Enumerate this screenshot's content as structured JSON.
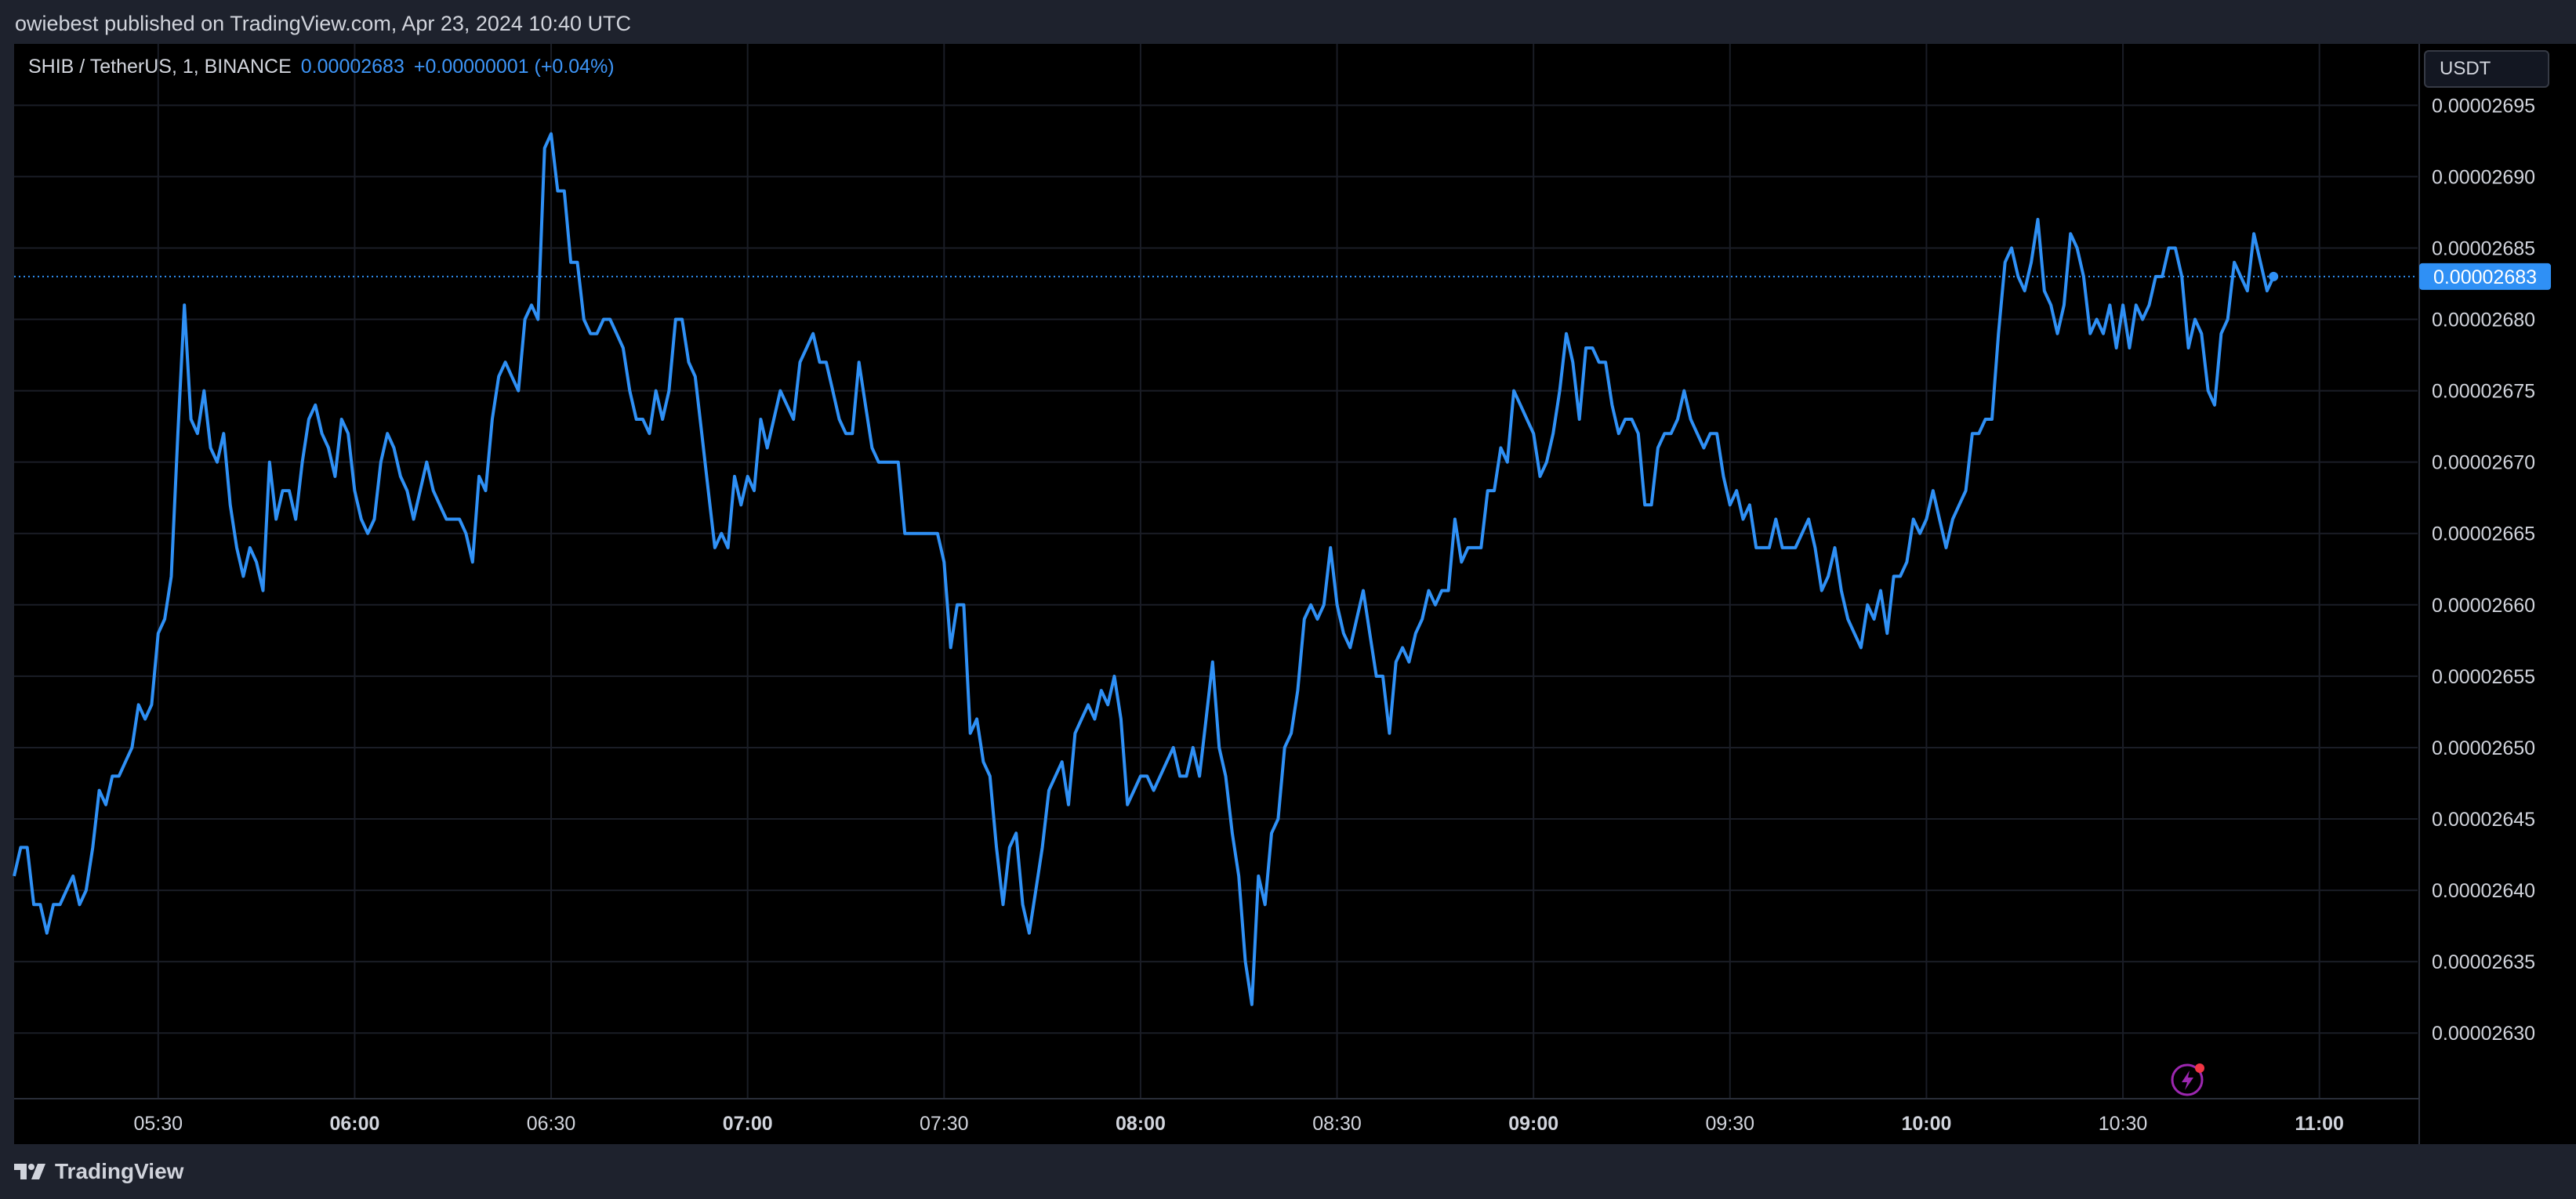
{
  "header": {
    "publish_text": "owiebest published on TradingView.com, Apr 23, 2024 10:40 UTC"
  },
  "legend": {
    "symbol": "SHIB / TetherUS, 1, BINANCE",
    "price": "0.00002683",
    "change": "+0.00000001 (+0.04%)"
  },
  "currency_button": "USDT",
  "footer": {
    "brand": "TradingView"
  },
  "colors": {
    "line": "#2f90f5",
    "price_label_bg": "#2f90f5",
    "background": "#000000",
    "grid": "#1a1d26",
    "axis_text": "#d1d4dc",
    "header_bg": "#1e222d"
  },
  "icons": {
    "lightning": "lightning-bolt-icon",
    "logo": "tradingview-logo-icon"
  },
  "chart_data": {
    "type": "line",
    "title": "SHIB / TetherUS, 1, BINANCE",
    "xlabel": "",
    "ylabel": "",
    "x_ticks": [
      {
        "label": "05:30",
        "min": 330,
        "bold": false
      },
      {
        "label": "06:00",
        "min": 360,
        "bold": true
      },
      {
        "label": "06:30",
        "min": 390,
        "bold": false
      },
      {
        "label": "07:00",
        "min": 420,
        "bold": true
      },
      {
        "label": "07:30",
        "min": 450,
        "bold": false
      },
      {
        "label": "08:00",
        "min": 480,
        "bold": true
      },
      {
        "label": "08:30",
        "min": 510,
        "bold": false
      },
      {
        "label": "09:00",
        "min": 540,
        "bold": true
      },
      {
        "label": "09:30",
        "min": 570,
        "bold": false
      },
      {
        "label": "10:00",
        "min": 600,
        "bold": true
      },
      {
        "label": "10:30",
        "min": 630,
        "bold": false
      },
      {
        "label": "11:00",
        "min": 660,
        "bold": true
      }
    ],
    "y_ticks": [
      "0.00002695",
      "0.00002690",
      "0.00002685",
      "0.00002680",
      "0.00002675",
      "0.00002670",
      "0.00002665",
      "0.00002660",
      "0.00002655",
      "0.00002650",
      "0.00002645",
      "0.00002640",
      "0.00002635",
      "0.00002630"
    ],
    "xlim_minutes": [
      308,
      675
    ],
    "ylim_units": [
      2625.4,
      2699.3
    ],
    "y_unit_scale": 1e-08,
    "last_price": "0.00002683",
    "last_price_value": 2683,
    "grid": true,
    "series": [
      {
        "x_minutes_start": 308,
        "x_minutes_step": 1,
        "values": [
          2641,
          2643,
          2643,
          2639,
          2639,
          2637,
          2639,
          2639,
          2640,
          2641,
          2639,
          2640,
          2643,
          2647,
          2646,
          2648,
          2648,
          2649,
          2650,
          2653,
          2652,
          2653,
          2658,
          2659,
          2662,
          2672,
          2681,
          2673,
          2672,
          2675,
          2671,
          2670,
          2672,
          2667,
          2664,
          2662,
          2664,
          2663,
          2661,
          2670,
          2666,
          2668,
          2668,
          2666,
          2670,
          2673,
          2674,
          2672,
          2671,
          2669,
          2673,
          2672,
          2668,
          2666,
          2665,
          2666,
          2670,
          2672,
          2671,
          2669,
          2668,
          2666,
          2668,
          2670,
          2668,
          2667,
          2666,
          2666,
          2666,
          2665,
          2663,
          2669,
          2668,
          2673,
          2676,
          2677,
          2676,
          2675,
          2680,
          2681,
          2680,
          2692,
          2693,
          2689,
          2689,
          2684,
          2684,
          2680,
          2679,
          2679,
          2680,
          2680,
          2679,
          2678,
          2675,
          2673,
          2673,
          2672,
          2675,
          2673,
          2675,
          2680,
          2680,
          2677,
          2676,
          2672,
          2668,
          2664,
          2665,
          2664,
          2669,
          2667,
          2669,
          2668,
          2673,
          2671,
          2673,
          2675,
          2674,
          2673,
          2677,
          2678,
          2679,
          2677,
          2677,
          2675,
          2673,
          2672,
          2672,
          2677,
          2674,
          2671,
          2670,
          2670,
          2670,
          2670,
          2665,
          2665,
          2665,
          2665,
          2665,
          2665,
          2663,
          2657,
          2660,
          2660,
          2651,
          2652,
          2649,
          2648,
          2643,
          2639,
          2643,
          2644,
          2639,
          2637,
          2640,
          2643,
          2647,
          2648,
          2649,
          2646,
          2651,
          2652,
          2653,
          2652,
          2654,
          2653,
          2655,
          2652,
          2646,
          2647,
          2648,
          2648,
          2647,
          2648,
          2649,
          2650,
          2648,
          2648,
          2650,
          2648,
          2652,
          2656,
          2650,
          2648,
          2644,
          2641,
          2635,
          2632,
          2641,
          2639,
          2644,
          2645,
          2650,
          2651,
          2654,
          2659,
          2660,
          2659,
          2660,
          2664,
          2660,
          2658,
          2657,
          2659,
          2661,
          2658,
          2655,
          2655,
          2651,
          2656,
          2657,
          2656,
          2658,
          2659,
          2661,
          2660,
          2661,
          2661,
          2666,
          2663,
          2664,
          2664,
          2664,
          2668,
          2668,
          2671,
          2670,
          2675,
          2674,
          2673,
          2672,
          2669,
          2670,
          2672,
          2675,
          2679,
          2677,
          2673,
          2678,
          2678,
          2677,
          2677,
          2674,
          2672,
          2673,
          2673,
          2672,
          2667,
          2667,
          2671,
          2672,
          2672,
          2673,
          2675,
          2673,
          2672,
          2671,
          2672,
          2672,
          2669,
          2667,
          2668,
          2666,
          2667,
          2664,
          2664,
          2664,
          2666,
          2664,
          2664,
          2664,
          2665,
          2666,
          2664,
          2661,
          2662,
          2664,
          2661,
          2659,
          2658,
          2657,
          2660,
          2659,
          2661,
          2658,
          2662,
          2662,
          2663,
          2666,
          2665,
          2666,
          2668,
          2666,
          2664,
          2666,
          2667,
          2668,
          2672,
          2672,
          2673,
          2673,
          2679,
          2684,
          2685,
          2683,
          2682,
          2684,
          2687,
          2682,
          2681,
          2679,
          2681,
          2686,
          2685,
          2683,
          2679,
          2680,
          2679,
          2681,
          2678,
          2681,
          2678,
          2681,
          2680,
          2681,
          2683,
          2683,
          2685,
          2685,
          2683,
          2678,
          2680,
          2679,
          2675,
          2674,
          2679,
          2680,
          2684,
          2683,
          2682,
          2686,
          2684,
          2682,
          2683
        ]
      }
    ]
  }
}
